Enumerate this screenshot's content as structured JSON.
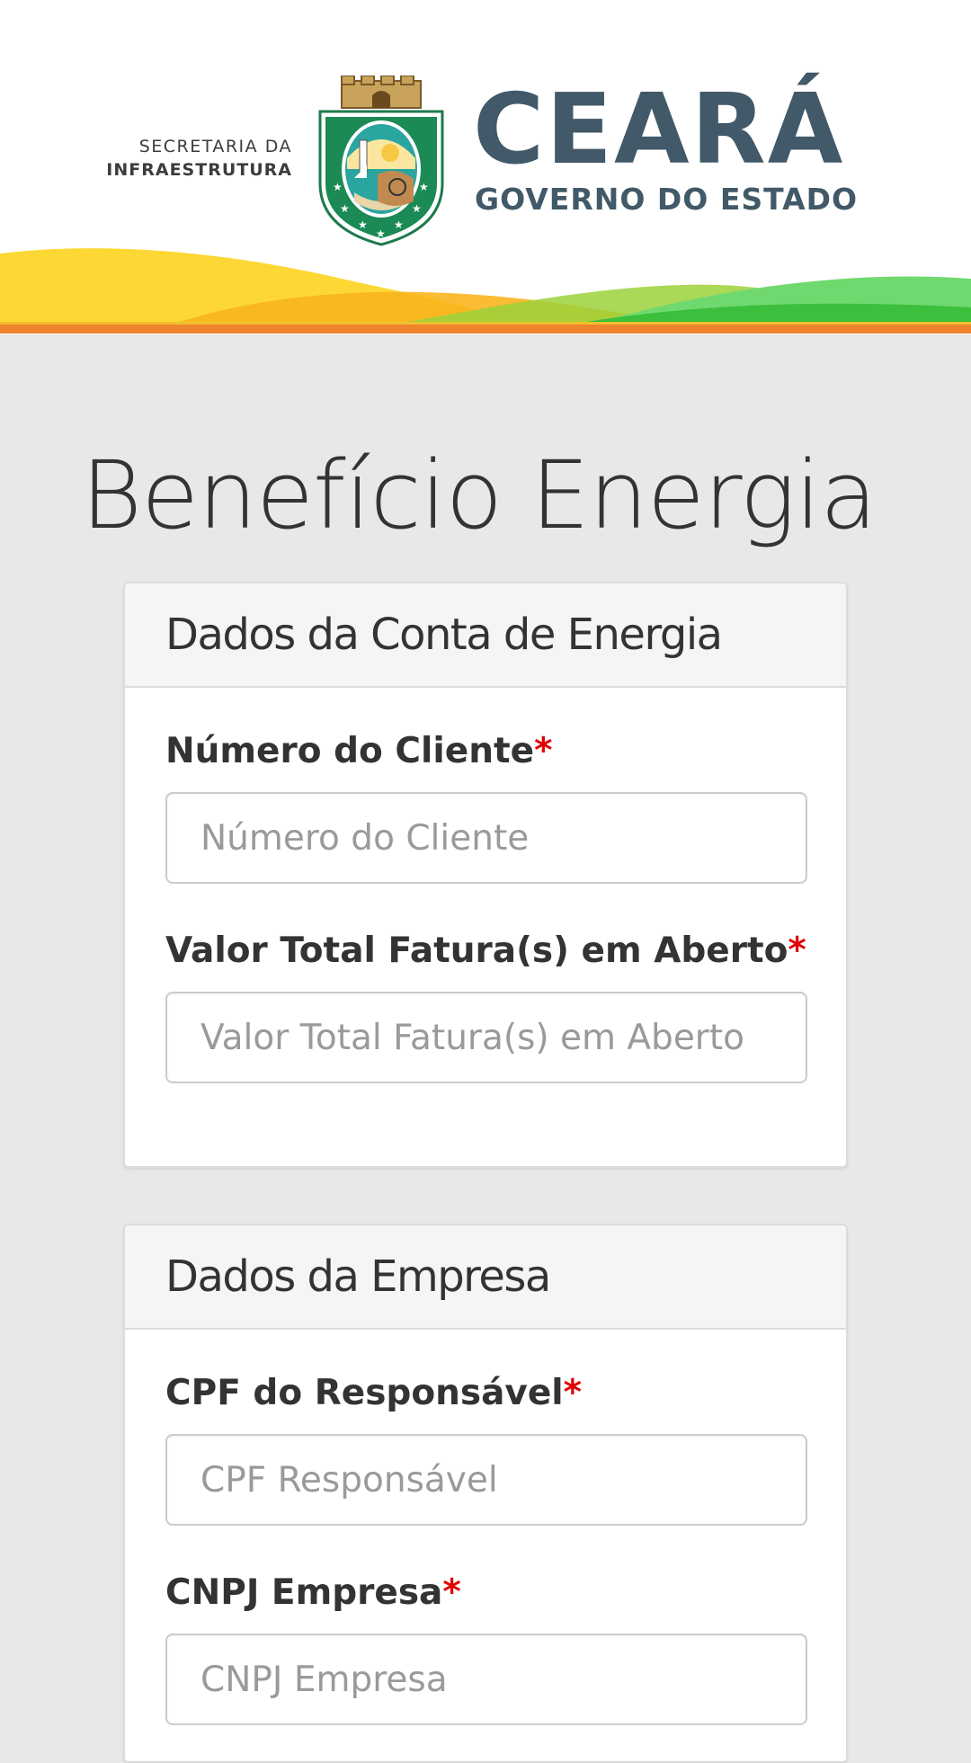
{
  "header": {
    "secretaria_line1": "SECRETARIA DA",
    "secretaria_line2": "INFRAESTRUTURA",
    "state_name": "CEARÁ",
    "state_subtitle": "GOVERNO DO ESTADO",
    "colors": {
      "brand_text": "#415968",
      "orange_line": "#f0842c",
      "wave_yellow": "#fdd835",
      "wave_green": "#4ccf4c"
    }
  },
  "page": {
    "title": "Benefício Energia"
  },
  "sections": [
    {
      "title": "Dados da Conta de Energia",
      "fields": [
        {
          "label": "Número do Cliente",
          "required_mark": "*",
          "placeholder": "Número do Cliente",
          "value": ""
        },
        {
          "label": "Valor Total Fatura(s) em Aberto",
          "required_mark": "*",
          "placeholder": "Valor Total Fatura(s) em Aberto",
          "value": ""
        }
      ]
    },
    {
      "title": "Dados da Empresa",
      "fields": [
        {
          "label": "CPF do Responsável",
          "required_mark": "*",
          "placeholder": "CPF Responsável",
          "value": ""
        },
        {
          "label": "CNPJ Empresa",
          "required_mark": "*",
          "placeholder": "CNPJ Empresa",
          "value": ""
        }
      ]
    }
  ]
}
